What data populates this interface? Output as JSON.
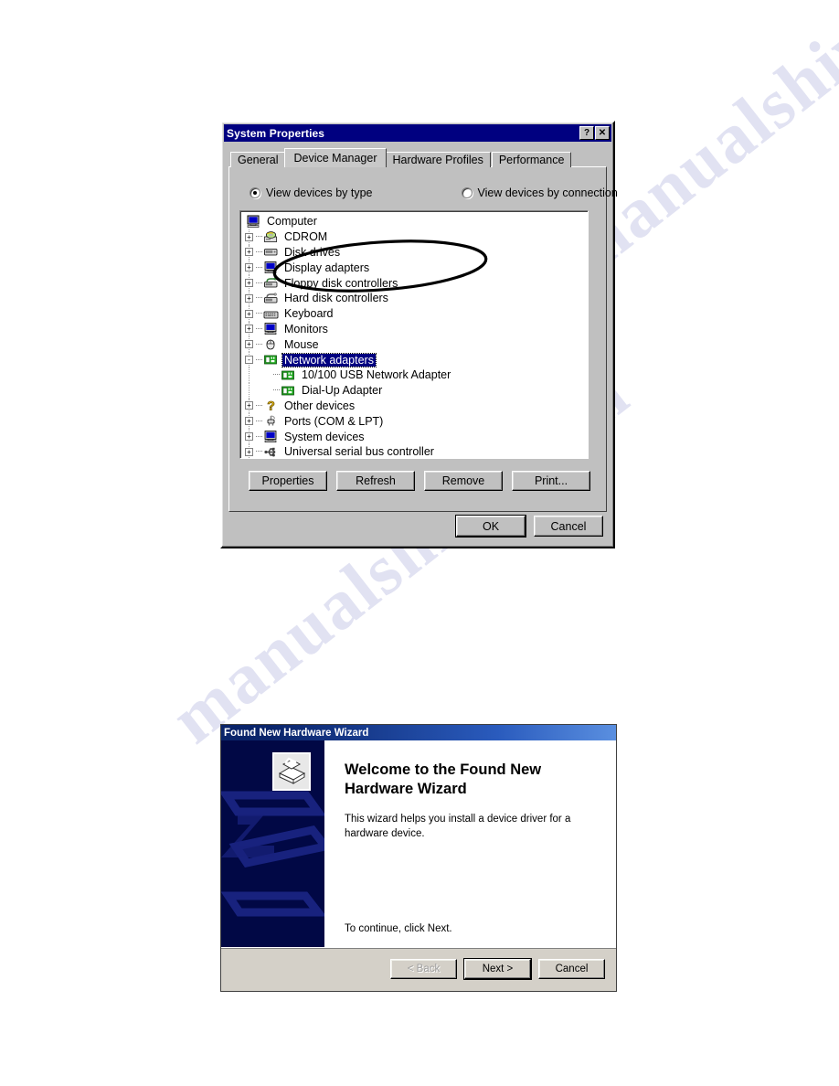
{
  "watermark": {
    "line1": "manualshive.com",
    "line2": "manualshive.com"
  },
  "system_properties": {
    "title": "System Properties",
    "titlebar_buttons": [
      {
        "name": "help-button",
        "glyph": "?"
      },
      {
        "name": "close-button",
        "glyph": "✕"
      }
    ],
    "tabs": [
      {
        "label": "General",
        "active": false
      },
      {
        "label": "Device Manager",
        "active": true
      },
      {
        "label": "Hardware Profiles",
        "active": false
      },
      {
        "label": "Performance",
        "active": false
      }
    ],
    "view_options": [
      {
        "label": "View devices by type",
        "selected": true
      },
      {
        "label": "View devices by connection",
        "selected": false
      }
    ],
    "device_tree": [
      {
        "label": "Computer",
        "level": 0,
        "expander": "none",
        "icon": "computer-icon",
        "selected": false
      },
      {
        "label": "CDROM",
        "level": 1,
        "expander": "+",
        "icon": "cdrom-icon",
        "selected": false
      },
      {
        "label": "Disk drives",
        "level": 1,
        "expander": "+",
        "icon": "disk-drive-icon",
        "selected": false
      },
      {
        "label": "Display adapters",
        "level": 1,
        "expander": "+",
        "icon": "display-adapter-icon",
        "selected": false
      },
      {
        "label": "Floppy disk controllers",
        "level": 1,
        "expander": "+",
        "icon": "floppy-controller-icon",
        "selected": false
      },
      {
        "label": "Hard disk controllers",
        "level": 1,
        "expander": "+",
        "icon": "hard-disk-controller-icon",
        "selected": false
      },
      {
        "label": "Keyboard",
        "level": 1,
        "expander": "+",
        "icon": "keyboard-icon",
        "selected": false
      },
      {
        "label": "Monitors",
        "level": 1,
        "expander": "+",
        "icon": "monitor-icon",
        "selected": false
      },
      {
        "label": "Mouse",
        "level": 1,
        "expander": "+",
        "icon": "mouse-icon",
        "selected": false
      },
      {
        "label": "Network adapters",
        "level": 1,
        "expander": "-",
        "icon": "network-adapter-icon",
        "selected": true
      },
      {
        "label": "10/100 USB Network Adapter",
        "level": 2,
        "expander": "none",
        "icon": "network-adapter-icon",
        "selected": false
      },
      {
        "label": "Dial-Up Adapter",
        "level": 2,
        "expander": "none",
        "icon": "network-adapter-icon",
        "selected": false
      },
      {
        "label": "Other devices",
        "level": 1,
        "expander": "+",
        "icon": "unknown-device-icon",
        "selected": false
      },
      {
        "label": "Ports (COM & LPT)",
        "level": 1,
        "expander": "+",
        "icon": "port-icon",
        "selected": false
      },
      {
        "label": "System devices",
        "level": 1,
        "expander": "+",
        "icon": "system-device-icon",
        "selected": false
      },
      {
        "label": "Universal serial bus controller",
        "level": 1,
        "expander": "+",
        "icon": "usb-icon",
        "selected": false
      }
    ],
    "action_buttons": [
      {
        "label": "Properties",
        "accel": "r"
      },
      {
        "label": "Refresh",
        "accel": "f"
      },
      {
        "label": "Remove",
        "accel": "e"
      },
      {
        "label": "Print...",
        "accel": "n"
      }
    ],
    "dialog_buttons": [
      {
        "label": "OK",
        "default": true
      },
      {
        "label": "Cancel",
        "default": false
      }
    ],
    "annotation": "hand-drawn-ellipse-around-network-adapters"
  },
  "hardware_wizard": {
    "title": "Found New Hardware Wizard",
    "heading": "Welcome to the Found New Hardware Wizard",
    "body": "This wizard helps you install a device driver for a hardware device.",
    "continue_hint": "To continue, click Next.",
    "buttons": [
      {
        "label": "< Back",
        "disabled": true,
        "default": false
      },
      {
        "label": "Next >",
        "disabled": false,
        "default": true
      },
      {
        "label": "Cancel",
        "disabled": false,
        "default": false
      }
    ]
  },
  "colors": {
    "win95_face": "#c0c0c0",
    "titlebar_navy": "#000080",
    "selection_navy": "#000080",
    "wizard_side": "#010845",
    "wizard_face": "#d4d0c8",
    "watermark": "#c9cbe8"
  }
}
